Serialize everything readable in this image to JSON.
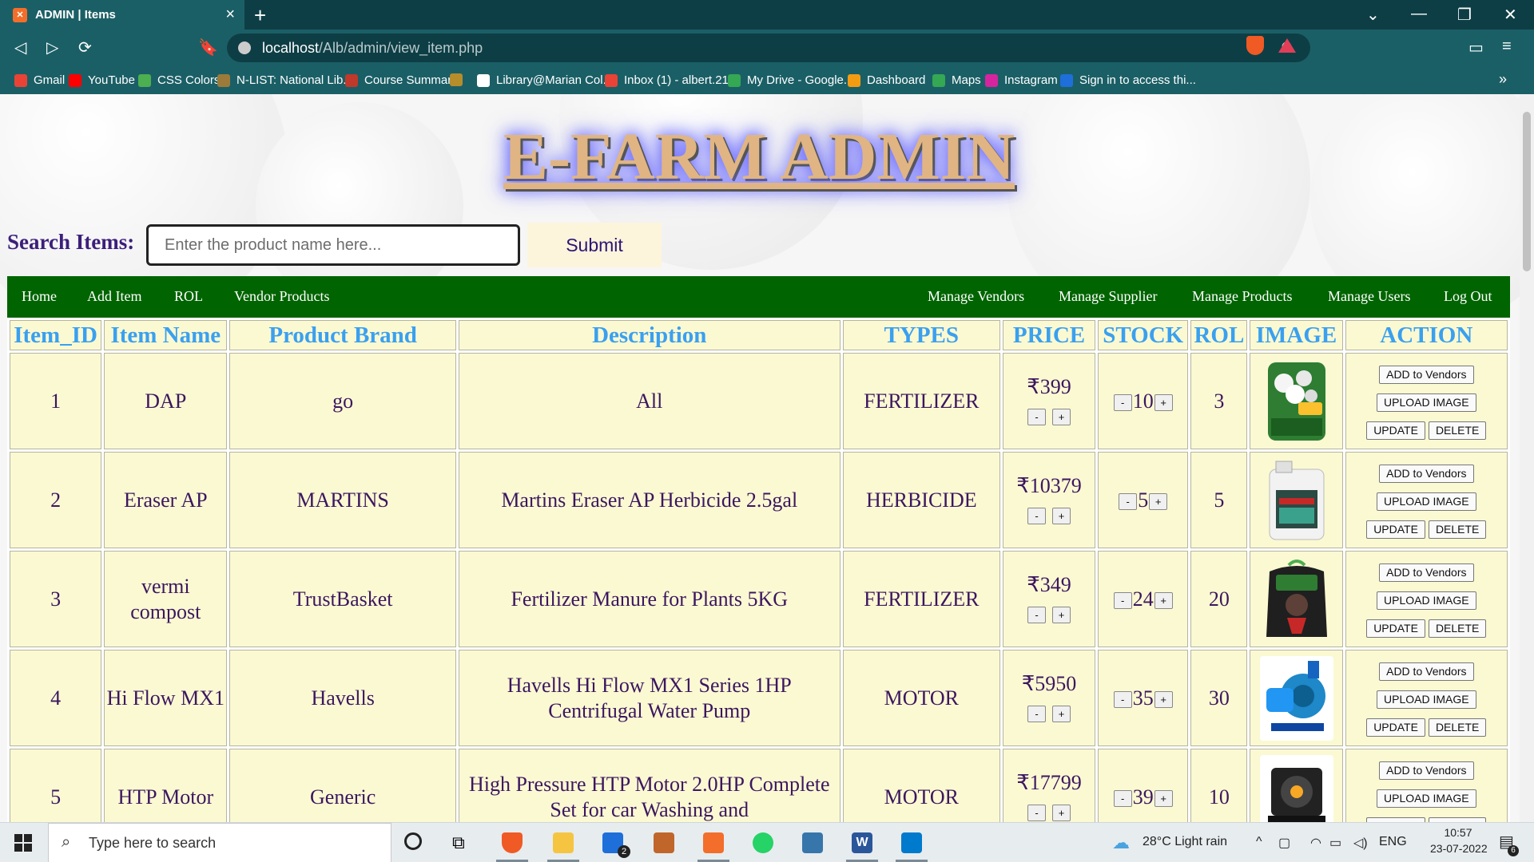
{
  "browser": {
    "tab_title": "ADMIN | Items",
    "url_host": "localhost",
    "url_path": "/Alb/admin/view_item.php",
    "bookmarks": [
      {
        "label": "Gmail",
        "color": "#ea4335"
      },
      {
        "label": "YouTube",
        "color": "#ff0000"
      },
      {
        "label": "CSS Colors",
        "color": "#4caf50"
      },
      {
        "label": "N-LIST: National Lib...",
        "color": "#9c7b3a"
      },
      {
        "label": "Course Summary",
        "color": "#c0392b"
      },
      {
        "label": "",
        "color": "#b58d2a"
      },
      {
        "label": "Library@Marian Col...",
        "color": "#ffffff"
      },
      {
        "label": "Inbox (1) - albert.21...",
        "color": "#ea4335"
      },
      {
        "label": "My Drive - Google...",
        "color": "#34a853"
      },
      {
        "label": "Dashboard",
        "color": "#f39c12"
      },
      {
        "label": "Maps",
        "color": "#34a853"
      },
      {
        "label": "Instagram",
        "color": "#d6249f"
      },
      {
        "label": "Sign in to access thi...",
        "color": "#1e6fd9"
      }
    ],
    "more_bookmarks": "»"
  },
  "header": {
    "brand_title": "E-FARM ADMIN"
  },
  "search": {
    "label": "Search Items:",
    "placeholder": "Enter the product name here...",
    "submit_label": "Submit"
  },
  "nav": {
    "left": [
      "Home",
      "Add Item",
      "ROL",
      "Vendor Products"
    ],
    "right": [
      "Manage Vendors",
      "Manage Supplier",
      "Manage Products",
      "Manage Users",
      "Log Out"
    ]
  },
  "table": {
    "columns": [
      "Item_ID",
      "Item Name",
      "Product Brand",
      "Description",
      "TYPES",
      "PRICE",
      "STOCK",
      "ROL",
      "IMAGE",
      "ACTION"
    ],
    "rows": [
      {
        "id": "1",
        "name": "DAP",
        "brand": "go",
        "description": "All",
        "type": "FERTILIZER",
        "price": "₹399",
        "stock": "10",
        "rol": "3",
        "image": "dap-bag"
      },
      {
        "id": "2",
        "name": "Eraser AP",
        "brand": "MARTINS",
        "description": "Martins Eraser AP Herbicide 2.5gal",
        "type": "HERBICIDE",
        "price": "₹10379",
        "stock": "5",
        "rol": "5",
        "image": "herbicide-jug"
      },
      {
        "id": "3",
        "name": "vermi compost",
        "brand": "TrustBasket",
        "description": "Fertilizer Manure for Plants 5KG",
        "type": "FERTILIZER",
        "price": "₹349",
        "stock": "24",
        "rol": "20",
        "image": "compost-bag"
      },
      {
        "id": "4",
        "name": "Hi Flow MX1",
        "brand": "Havells",
        "description": "Havells Hi Flow MX1 Series 1HP Centrifugal Water Pump",
        "type": "MOTOR",
        "price": "₹5950",
        "stock": "35",
        "rol": "30",
        "image": "water-pump"
      },
      {
        "id": "5",
        "name": "HTP Motor",
        "brand": "Generic",
        "description": "High Pressure HTP Motor 2.0HP Complete Set for car Washing and",
        "type": "MOTOR",
        "price": "₹17799",
        "stock": "39",
        "rol": "10",
        "image": "htp-motor"
      }
    ],
    "actions": {
      "add_vendors": "ADD to Vendors",
      "upload_image": "UPLOAD IMAGE",
      "update": "UPDATE",
      "delete": "DELETE"
    },
    "minus": "-",
    "plus": "+"
  },
  "taskbar": {
    "search_placeholder": "Type here to search",
    "weather": "28°C  Light rain",
    "language": "ENG",
    "time": "10:57",
    "date": "23-07-2022",
    "mail_badge": "2",
    "notification_count": "6"
  }
}
